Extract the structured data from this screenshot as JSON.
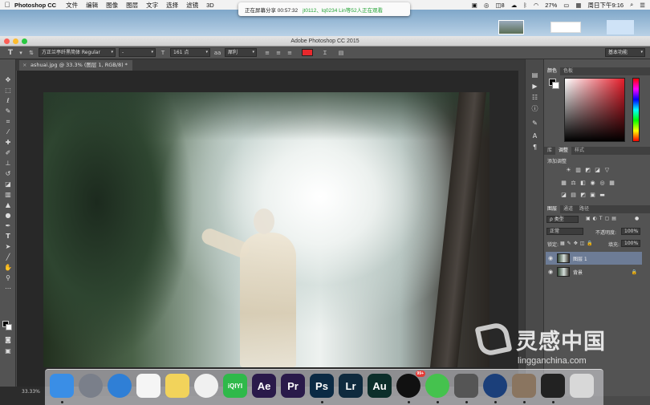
{
  "menubar": {
    "app_name": "Photoshop CC",
    "items": [
      "文件",
      "编辑",
      "图像",
      "图层",
      "文字",
      "选择",
      "滤镜",
      "3D"
    ],
    "battery": "27%",
    "clock": "周日下午9:16",
    "badge": "8"
  },
  "share_banner": {
    "status": "正在屏幕分享 00:57:32",
    "viewers": "jt0112、lq0234 Lin等52人正在观看"
  },
  "window": {
    "title": "Adobe Photoshop CC 2015"
  },
  "options_bar": {
    "tool_glyph": "T",
    "font_family": "方正兰亭纤黑简体 Regular",
    "font_style": "-",
    "font_size": "161 点",
    "aa_glyph": "aa",
    "anti_alias": "犀利",
    "text_color": "#e8282c",
    "workspace": "基本功能"
  },
  "document": {
    "tab_label": "ashuai.jpg @ 33.3% (图层 1, RGB/8) *",
    "zoom": "33.33%"
  },
  "panels": {
    "color_tabs": [
      "颜色",
      "色板"
    ],
    "adjust_tabs": [
      "库",
      "调整",
      "样式"
    ],
    "adjust_title": "添加调整",
    "layer_tabs": [
      "图层",
      "通道",
      "路径"
    ],
    "filter_kind": "ρ 类型",
    "blend_mode": "正常",
    "opacity_label": "不透明度:",
    "opacity_value": "100%",
    "lock_label": "锁定:",
    "fill_label": "填充:",
    "fill_value": "100%",
    "layers": [
      {
        "name": "图层 1",
        "selected": true
      },
      {
        "name": "背景",
        "selected": false,
        "locked": true
      }
    ]
  },
  "watermark": {
    "cn": "灵感中国",
    "en": "lingganchina.com"
  },
  "dock": {
    "apps": [
      {
        "name": "finder",
        "label": "",
        "color": "#3a8ee6"
      },
      {
        "name": "launchpad",
        "label": "",
        "color": "#7a7f8a"
      },
      {
        "name": "safari",
        "label": "",
        "color": "#2f7fd6"
      },
      {
        "name": "reminders",
        "label": "",
        "color": "#f5f5f5"
      },
      {
        "name": "notes",
        "label": "",
        "color": "#f2d35b"
      },
      {
        "name": "photos",
        "label": "",
        "color": "#f0f0f0"
      },
      {
        "name": "iqiyi",
        "label": "iQIYI",
        "color": "#2fb94a"
      },
      {
        "name": "after-effects",
        "label": "Ae",
        "color": "#2a1a4a"
      },
      {
        "name": "premiere",
        "label": "Pr",
        "color": "#2a1a4a"
      },
      {
        "name": "photoshop",
        "label": "Ps",
        "color": "#0b2a44"
      },
      {
        "name": "lightroom",
        "label": "Lr",
        "color": "#0f2a3e"
      },
      {
        "name": "audition",
        "label": "Au",
        "color": "#0c2e2a"
      },
      {
        "name": "qq",
        "label": "",
        "color": "#111111"
      },
      {
        "name": "wechat",
        "label": "",
        "color": "#45c24e"
      },
      {
        "name": "screenshot",
        "label": "",
        "color": "#555555"
      },
      {
        "name": "quicktime",
        "label": "",
        "color": "#1b3f7a"
      },
      {
        "name": "preview",
        "label": "",
        "color": "#8a7560"
      },
      {
        "name": "terminal",
        "label": "",
        "color": "#222222"
      },
      {
        "name": "trash",
        "label": "",
        "color": "#d8d8d8"
      }
    ],
    "qq_badge": "99+"
  }
}
